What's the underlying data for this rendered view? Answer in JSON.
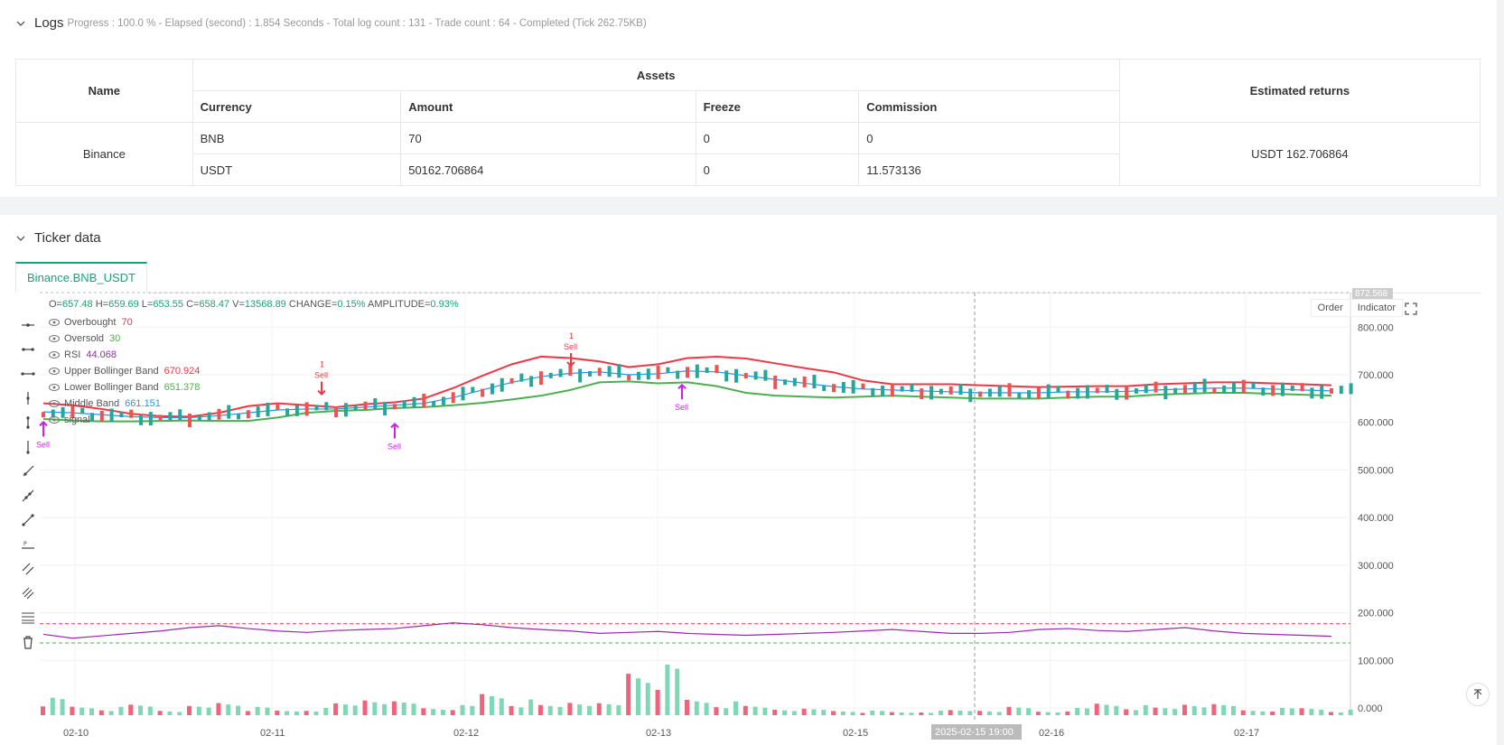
{
  "logs": {
    "title": "Logs",
    "progress": "Progress : 100.0 % - Elapsed (second) : 1.854  Seconds - Total log count : 131 - Trade count : 64 - Completed (Tick 262.75KB)"
  },
  "assets_table": {
    "name_header": "Name",
    "assets_header": "Assets",
    "returns_header": "Estimated returns",
    "columns": [
      "Currency",
      "Amount",
      "Freeze",
      "Commission"
    ],
    "exchange": "Binance",
    "rows": [
      {
        "currency": "BNB",
        "amount": "70",
        "freeze": "0",
        "commission": "0"
      },
      {
        "currency": "USDT",
        "amount": "50162.706864",
        "freeze": "0",
        "commission": "11.573136"
      }
    ],
    "estimated_returns": "USDT 162.706864"
  },
  "ticker": {
    "title": "Ticker data",
    "tab": "Binance.BNB_USDT"
  },
  "chart": {
    "ohlc": {
      "o": "657.48",
      "h": "659.69",
      "l": "653.55",
      "c": "658.47",
      "v": "13568.89",
      "change": "0.15%",
      "amplitude": "0.93%"
    },
    "ohlc_labels": {
      "o": "O=",
      "h": "H=",
      "l": "L=",
      "c": "C=",
      "v": "V=",
      "change": "CHANGE=",
      "amplitude": "AMPLITUDE="
    },
    "legend": [
      {
        "name": "Overbought",
        "value": "70",
        "color": "#f23645"
      },
      {
        "name": "Oversold",
        "value": "30",
        "color": "#4caf50"
      },
      {
        "name": "RSI",
        "value": "44.068",
        "color": "#9c27b0"
      },
      {
        "name": "Upper Bollinger Band",
        "value": "670.924",
        "color": "#f23645"
      },
      {
        "name": "Lower Bollinger Band",
        "value": "651.378",
        "color": "#4caf50"
      },
      {
        "name": "Middle Band",
        "value": "661.151",
        "color": "#2196f3"
      },
      {
        "name": "signal",
        "value": "",
        "color": "#888888"
      }
    ],
    "buttons": {
      "order": "Order",
      "indicator": "Indicator"
    },
    "price_top_label": "872.568",
    "crosshair_time": "2025-02-15 19:00",
    "y_ticks": [
      "800.000",
      "700.000",
      "600.000",
      "500.000",
      "400.000",
      "300.000",
      "200.000",
      "100.000",
      "0.000"
    ],
    "x_ticks": [
      "02-10",
      "02-11",
      "02-12",
      "02-13",
      "02-15",
      "02-16",
      "02-17"
    ],
    "signals": [
      {
        "label": "Sell",
        "dir": "up",
        "qty": ""
      },
      {
        "label": "Sell",
        "dir": "down",
        "qty": "1"
      },
      {
        "label": "Sell",
        "dir": "up",
        "qty": ""
      },
      {
        "label": "Sell",
        "dir": "down",
        "qty": "1"
      },
      {
        "label": "Sell",
        "dir": "up",
        "qty": ""
      }
    ]
  },
  "chart_data": {
    "type": "line",
    "series": [
      {
        "name": "Upper Bollinger Band",
        "values": [
          640,
          636,
          628,
          618,
          613,
          612,
          620,
          634,
          640,
          636,
          632,
          638,
          642,
          650,
          672,
          698,
          722,
          738,
          735,
          728,
          716,
          722,
          735,
          738,
          734,
          724,
          714,
          705,
          688,
          680,
          680,
          680,
          678,
          676,
          674,
          675,
          676,
          676,
          680,
          682,
          684,
          684,
          682,
          680,
          678
        ]
      },
      {
        "name": "Middle Band",
        "values": [
          622,
          620,
          616,
          612,
          610,
          610,
          614,
          620,
          626,
          628,
          628,
          632,
          636,
          640,
          652,
          668,
          684,
          696,
          703,
          706,
          700,
          702,
          708,
          706,
          698,
          690,
          682,
          675,
          670,
          668,
          666,
          664,
          662,
          662,
          662,
          664,
          664,
          665,
          668,
          670,
          672,
          672,
          670,
          668,
          666
        ]
      },
      {
        "name": "Lower Bollinger Band",
        "values": [
          607,
          604,
          602,
          602,
          603,
          604,
          603,
          603,
          610,
          620,
          624,
          626,
          630,
          632,
          636,
          641,
          648,
          656,
          668,
          684,
          686,
          682,
          684,
          676,
          662,
          656,
          654,
          652,
          654,
          656,
          654,
          652,
          650,
          650,
          650,
          652,
          654,
          654,
          658,
          660,
          662,
          662,
          660,
          658,
          656
        ]
      },
      {
        "name": "RSI",
        "values": [
          48,
          40,
          45,
          50,
          55,
          62,
          66,
          60,
          55,
          52,
          56,
          58,
          60,
          66,
          72,
          68,
          62,
          58,
          55,
          50,
          52,
          54,
          50,
          48,
          46,
          48,
          50,
          52,
          55,
          58,
          54,
          50,
          50,
          52,
          58,
          60,
          56,
          54,
          58,
          62,
          55,
          50,
          48,
          46,
          44
        ]
      },
      {
        "name": "Overbought",
        "values": [
          70
        ]
      },
      {
        "name": "Oversold",
        "values": [
          30
        ]
      }
    ],
    "volume": [
      38,
      22,
      18,
      25,
      14,
      20,
      35,
      18,
      12,
      16,
      28,
      48,
      30,
      20,
      22,
      55,
      34,
      24,
      40,
      26,
      120,
      110,
      40,
      30,
      22,
      18,
      14,
      12,
      10,
      8,
      10,
      12,
      14,
      18,
      10,
      16,
      30,
      22,
      18,
      34,
      24,
      14,
      16,
      18,
      12
    ],
    "ylim": [
      0,
      872.568
    ],
    "x_categories": [
      "02-10",
      "02-11",
      "02-12",
      "02-13",
      "02-15",
      "02-16",
      "02-17"
    ]
  }
}
